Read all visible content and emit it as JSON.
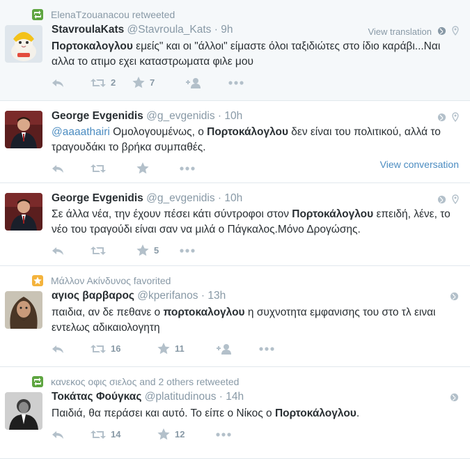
{
  "tweets": [
    {
      "context": "ElenaTzouanacou retweeted",
      "fullname": "StavroulaKats",
      "username": "@Stavroula_Kats",
      "time": "9h",
      "view_translation": "View translation",
      "text_html": "<b>Πορτοκαλογλου</b> εμείς\" και οι \"άλλοι\" είμαστε όλοι ταξιδιώτες στο ίδιο καράβι...Ναι αλλα το ατιμο εχει καταστρωματα φιλε μου",
      "retweets": "2",
      "favorites": "7"
    },
    {
      "fullname": "George Evgenidis",
      "username": "@g_evgenidis",
      "time": "10h",
      "text_html": "<span class=\"mention\">@aaaathairi</span> Ομολογουμένως, ο <b>Πορτοκάλογλου</b> δεν είναι του πολιτικού, αλλά το τραγουδάκι το βρήκα συμπαθές.",
      "view_conversation": "View conversation"
    },
    {
      "fullname": "George Evgenidis",
      "username": "@g_evgenidis",
      "time": "10h",
      "text_html": "Σε άλλα νέα, την έχουν πέσει κάτι σύντροφοι στον <b>Πορτοκάλογλου</b> επειδή, λένε, το νέο του τραγούδι είναι σαν να μιλά ο Πάγκαλος.Μόνο Δρογώσης.",
      "favorites": "5"
    },
    {
      "context": "Μάλλον Ακίνδυνος favorited",
      "fullname": "αγιος βαρβαρος",
      "username": "@kperifanos",
      "time": "13h",
      "text_html": "παιδια, αν δε πεθανε ο <b>πορτοκαλογλου</b> η συχνοτητα εμφανισης του στο τλ ειναι εντελως αδικαιολογητη",
      "retweets": "16",
      "favorites": "11"
    },
    {
      "context": "κανεκος οφις σιελος and 2 others retweeted",
      "fullname": "Τοκάτας Φούγκας",
      "username": "@platitudinous",
      "time": "14h",
      "text_html": "Παιδιά, θα περάσει και αυτό. Το είπε ο Νίκος ο <b>Πορτοκάλογλου</b>.",
      "retweets": "14",
      "favorites": "12"
    }
  ],
  "icons": {
    "reply": "reply-icon",
    "retweet": "retweet-icon",
    "favorite": "star-icon",
    "follow": "follow-icon",
    "more": "more-icon",
    "globe": "globe-icon",
    "pin": "location-pin-icon"
  },
  "colors": {
    "link": "#4b8cc1",
    "muted": "#8899a6",
    "retweet_badge": "#5ea540",
    "favorite_badge": "#f4b33c",
    "highlight_bg": "#f5f8fa"
  }
}
